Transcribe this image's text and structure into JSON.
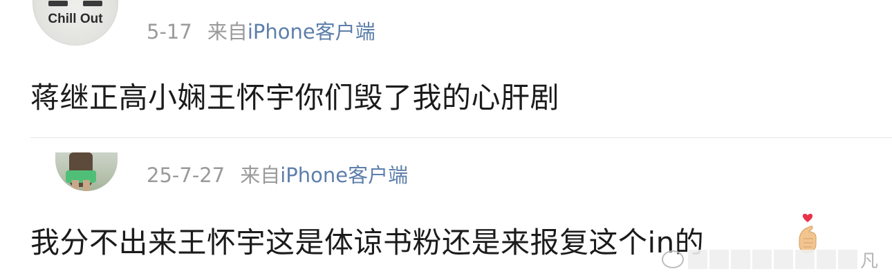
{
  "posts": [
    {
      "avatar_text": "Chill Out",
      "date": "5-17",
      "source": "来自",
      "client": "iPhone客户端",
      "content": "蒋继正高小娴王怀宇你们毁了我的心肝剧"
    },
    {
      "date": "25-7-27",
      "source": "来自",
      "client": "iPhone客户端",
      "content": "我分不出来王怀宇这是体谅书粉还是来报复这个in的",
      "emoji": "finger-heart-icon"
    }
  ],
  "watermark": {
    "text": "凡"
  },
  "colors": {
    "meta_gray": "#9a9a9a",
    "link_blue": "#5d7fab",
    "text": "#1b1b1b",
    "heart_red": "#e8334a"
  }
}
